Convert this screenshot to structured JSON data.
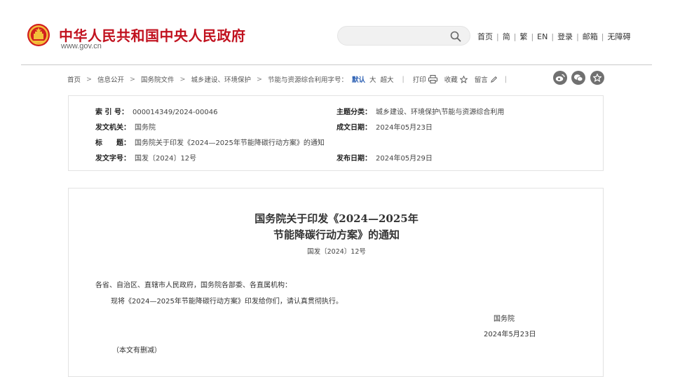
{
  "header": {
    "site_title": "中华人民共和国中央人民政府",
    "site_domain": "www.gov.cn",
    "search_placeholder": "",
    "nav": [
      "首页",
      "简",
      "繁",
      "EN",
      "登录",
      "邮箱",
      "无障碍"
    ]
  },
  "toolbar": {
    "breadcrumb": [
      "首页",
      "信息公开",
      "国务院文件",
      "城乡建设、环境保护",
      "节能与资源综合利用"
    ],
    "font_label": "字号：",
    "font_sizes": [
      "默认",
      "大",
      "超大"
    ],
    "active_size": "默认",
    "print": "打印",
    "favorite": "收藏",
    "comment": "留言",
    "social_icons": [
      "weibo-icon",
      "wechat-icon",
      "favorite-star-icon"
    ]
  },
  "info": {
    "index_label": "索 引 号：",
    "index_value": "000014349/2024-00046",
    "topic_label": "主题分类：",
    "topic_value": "城乡建设、环境保护\\节能与资源综合利用",
    "issuer_label": "发文机关：",
    "issuer_value": "国务院",
    "created_label": "成文日期：",
    "created_value": "2024年05月23日",
    "title_label": "标　　题：",
    "title_value": "国务院关于印发《2024—2025年节能降碳行动方案》的通知",
    "docno_label": "发文字号：",
    "docno_value": "国发〔2024〕12号",
    "published_label": "发布日期：",
    "published_value": "2024年05月29日"
  },
  "document": {
    "title_line1": "国务院关于印发《2024—2025年",
    "title_line2": "节能降碳行动方案》的通知",
    "doc_number": "国发〔2024〕12号",
    "salutation": "各省、自治区、直辖市人民政府，国务院各部委、各直属机构：",
    "body": "现将《2024—2025年节能降碳行动方案》印发给你们，请认真贯彻执行。",
    "signature": "国务院",
    "date": "2024年5月23日",
    "note": "（本文有删减）"
  },
  "colors": {
    "brand_red": "#c1121f",
    "active_blue": "#2b5fb3",
    "icon_gray": "#707070"
  }
}
